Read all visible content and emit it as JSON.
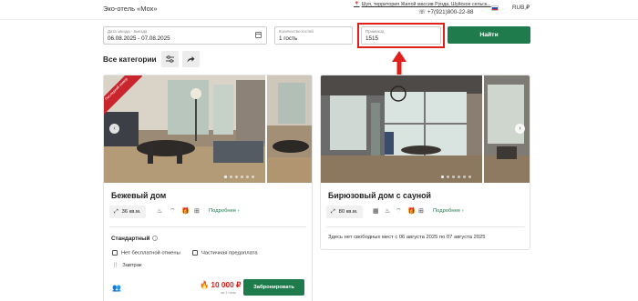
{
  "header": {
    "hotel_name": "Эко-отель «Мох»",
    "address": "Шуя, территория Жилой массив Рунда, Шуйское сельск...",
    "phone": "+7(921)800-22-88",
    "currency": "RUB,₽"
  },
  "search": {
    "dates_label": "Дата заезда - выезда",
    "dates_value": "06.08.2025 - 07.08.2025",
    "guests_label": "Количество гостей",
    "guests_value": "1 гость",
    "promo_label": "Промокод",
    "promo_value": "1515",
    "find_label": "Найти"
  },
  "category": {
    "title": "Все категории"
  },
  "cards": [
    {
      "ribbon": "Последний номер",
      "title": "Бежевый дом",
      "area": "36 кв.м.",
      "details_label": "Подробнее",
      "tariff": "Стандартный",
      "conditions": [
        "Нет бесплатной отмены",
        "Частичная предоплата"
      ],
      "meal": "Завтрак",
      "price": "10 000 ₽",
      "price_note": "за 1 ночь",
      "book_label": "Забронировать"
    },
    {
      "title": "Бирюзовый дом с сауной",
      "area": "80 кв.м.",
      "details_label": "Подробнее",
      "no_rooms": "Здесь нет свободных мест с 06 августа 2025 по 07 августа 2025"
    }
  ],
  "colors": {
    "accent": "#1f7a4c",
    "alert": "#e0201b"
  }
}
